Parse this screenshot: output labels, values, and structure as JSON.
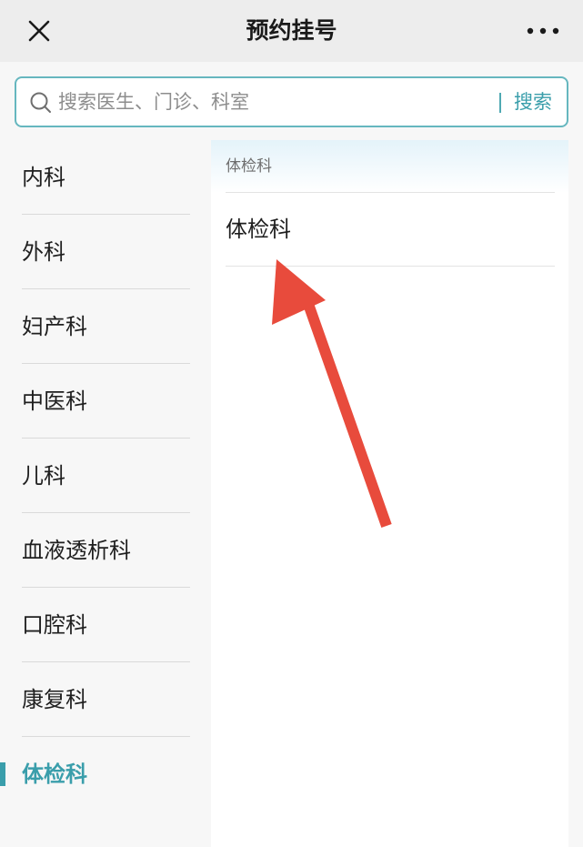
{
  "header": {
    "title": "预约挂号"
  },
  "search": {
    "placeholder": "搜索医生、门诊、科室",
    "value": "",
    "button_label": "搜索"
  },
  "sidebar": {
    "items": [
      {
        "label": "内科",
        "active": false
      },
      {
        "label": "外科",
        "active": false
      },
      {
        "label": "妇产科",
        "active": false
      },
      {
        "label": "中医科",
        "active": false
      },
      {
        "label": "儿科",
        "active": false
      },
      {
        "label": "血液透析科",
        "active": false
      },
      {
        "label": "口腔科",
        "active": false
      },
      {
        "label": "康复科",
        "active": false
      },
      {
        "label": "体检科",
        "active": true
      }
    ]
  },
  "content": {
    "section_title": "体检科",
    "departments": [
      "体检科"
    ]
  },
  "colors": {
    "accent": "#3a9eab",
    "search_border": "#66b7bf",
    "arrow": "#e84b3c"
  },
  "icons": {
    "close": "close-icon",
    "more": "more-icon",
    "search": "search-icon",
    "annotation": "red-arrow-icon"
  }
}
